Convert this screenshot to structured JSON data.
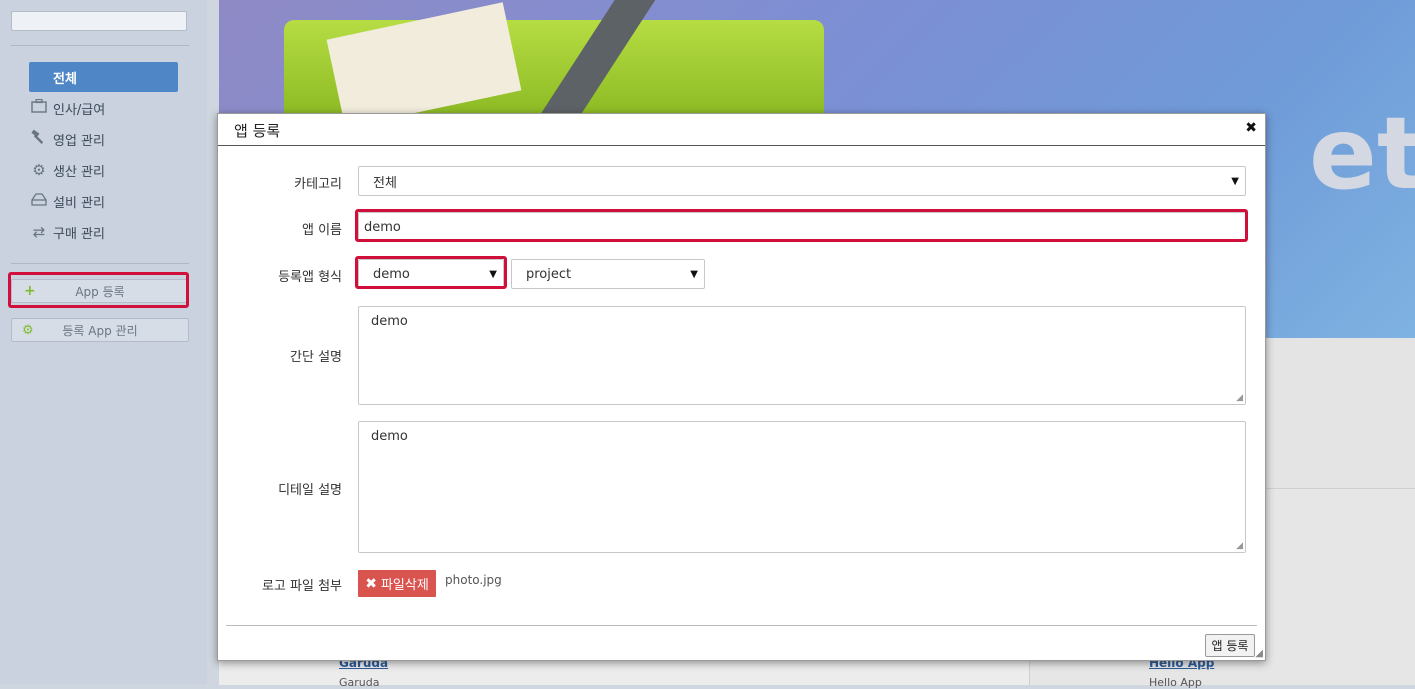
{
  "sidebar": {
    "search_value": "",
    "items": [
      {
        "label": "전체",
        "icon": "all-icon",
        "active": true
      },
      {
        "label": "인사/급여",
        "icon": "briefcase-icon"
      },
      {
        "label": "영업 관리",
        "icon": "hammer-icon"
      },
      {
        "label": "생산 관리",
        "icon": "gear-icon"
      },
      {
        "label": "설비 관리",
        "icon": "tray-icon"
      },
      {
        "label": "구매 관리",
        "icon": "exchange-icon"
      }
    ],
    "app_register_label": "App 등록",
    "app_manage_label": "등록 App 관리"
  },
  "background": {
    "banner_word": "et",
    "link_left": "Garuda",
    "sub_left": "Garuda",
    "link_right": "Hello App",
    "sub_right": "Hello App"
  },
  "modal": {
    "title": "앱 등록",
    "close_glyph": "✖",
    "fields": {
      "category_label": "카테고리",
      "category_value": "전체",
      "app_name_label": "앱 이름",
      "app_name_value": "demo",
      "type_label": "등록앱 형식",
      "type_value_1": "demo",
      "type_value_2": "project",
      "short_desc_label": "간단 설명",
      "short_desc_value": "demo",
      "detail_desc_label": "디테일 설명",
      "detail_desc_value": "demo",
      "logo_label": "로고 파일 첨부",
      "delete_file_label": "파일삭제",
      "file_name": "photo.jpg"
    },
    "submit_label": "앱 등록"
  },
  "colors": {
    "highlight": "#d0103a",
    "accent": "#4f86c6",
    "delete": "#d9534f"
  }
}
